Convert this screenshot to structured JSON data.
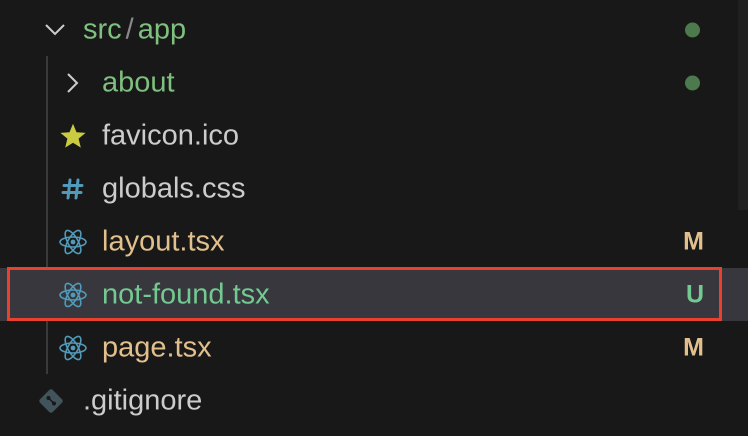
{
  "explorer": {
    "folder": {
      "parts": [
        "src",
        "app"
      ],
      "separator": "/",
      "expanded": true,
      "color": "#7fbf7f",
      "status_dot_color": "#4d7a4d"
    },
    "items": [
      {
        "label": "about",
        "type": "folder",
        "icon": "chevron-right-icon",
        "color": "#7fbf7f",
        "status": "dot"
      },
      {
        "label": "favicon.ico",
        "type": "file",
        "icon": "star-icon",
        "color": "#cccccc",
        "status": ""
      },
      {
        "label": "globals.css",
        "type": "file",
        "icon": "hash-icon",
        "color": "#cccccc",
        "status": ""
      },
      {
        "label": "layout.tsx",
        "type": "file",
        "icon": "react-icon",
        "color": "#e2c08d",
        "status": "M"
      },
      {
        "label": "not-found.tsx",
        "type": "file",
        "icon": "react-icon",
        "color": "#73c991",
        "status": "U",
        "selected": true
      },
      {
        "label": "page.tsx",
        "type": "file",
        "icon": "react-icon",
        "color": "#e2c08d",
        "status": "M"
      }
    ],
    "root_items": [
      {
        "label": ".gitignore",
        "type": "file",
        "icon": "git-icon",
        "color": "#cccccc",
        "status": ""
      }
    ],
    "colors": {
      "modified": "#e2c08d",
      "untracked": "#73c991",
      "highlight_border": "#e8422e",
      "react_icon": "#519aba",
      "css_icon": "#519aba",
      "star_icon": "#cbcb41",
      "git_icon": "#41535b"
    }
  }
}
